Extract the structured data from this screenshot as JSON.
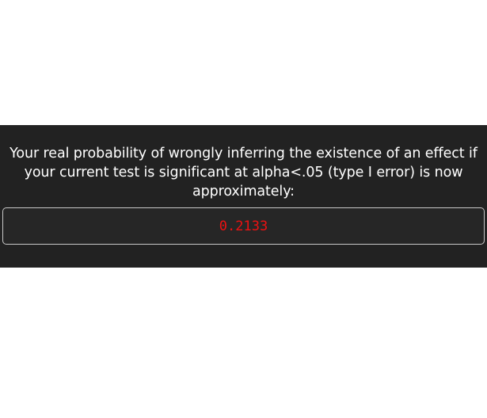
{
  "panel": {
    "message": "Your real probability of wrongly inferring the existence of an effect if your current test is significant at alpha<.05 (type I error) is now approximately:",
    "result_value": "0.2133"
  },
  "colors": {
    "panel_background": "#222222",
    "result_box_background": "#262626",
    "result_box_border": "#c9c9c9",
    "message_text": "#ffffff",
    "result_text": "#ee1111"
  }
}
